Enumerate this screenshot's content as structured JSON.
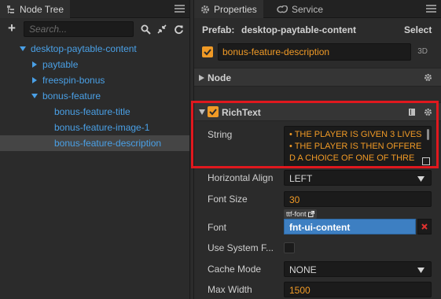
{
  "node_tree": {
    "tab_label": "Node Tree",
    "search_placeholder": "Search...",
    "items": [
      {
        "label": "desktop-paytable-content",
        "expanded": true
      },
      {
        "label": "paytable",
        "expanded": false
      },
      {
        "label": "freespin-bonus",
        "expanded": false
      },
      {
        "label": "bonus-feature",
        "expanded": true
      },
      {
        "label": "bonus-feature-title"
      },
      {
        "label": "bonus-feature-image-1"
      },
      {
        "label": "bonus-feature-description",
        "selected": true
      }
    ]
  },
  "properties": {
    "tab_label": "Properties",
    "service_tab_label": "Service",
    "prefab_label": "Prefab:",
    "prefab_name": "desktop-paytable-content",
    "select_label": "Select",
    "node_name": "bonus-feature-description",
    "badge_3d": "3D",
    "node_section": "Node",
    "richtext_section": "RichText",
    "fields": {
      "string_label": "String",
      "string_value": "• THE PLAYER IS GIVEN 3 LIVES\n• THE PLAYER IS THEN OFFERED A CHOICE OF ONE OF THRE",
      "halign_label": "Horizontal Align",
      "halign_value": "LEFT",
      "font_size_label": "Font Size",
      "font_size_value": "30",
      "font_label": "Font",
      "font_tag": "ttf-font",
      "font_value": "fnt-ui-content",
      "use_system_font_label": "Use System F...",
      "cache_mode_label": "Cache Mode",
      "cache_mode_value": "NONE",
      "max_width_label": "Max Width",
      "max_width_value": "1500"
    }
  },
  "colors": {
    "accent_orange": "#f09a26",
    "tree_blue": "#4aa0e6",
    "highlight_red": "#e0181e",
    "font_asset_blue": "#3d7fc2"
  }
}
